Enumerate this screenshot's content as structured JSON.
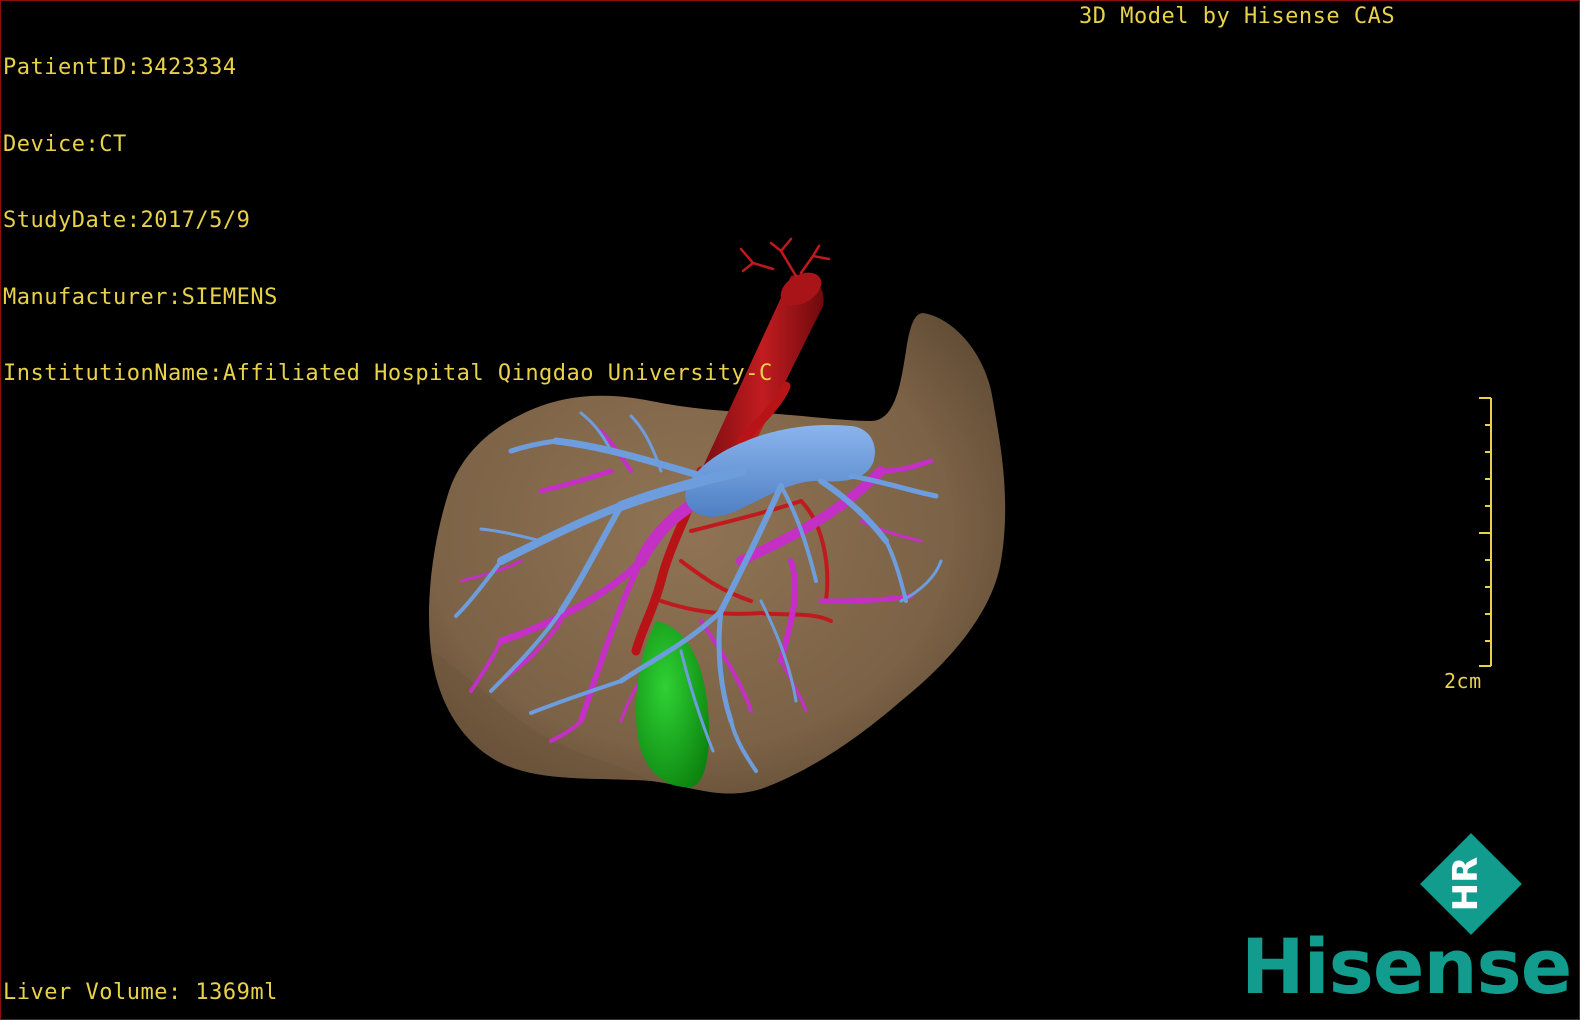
{
  "info": {
    "patient_id": "PatientID:3423334",
    "device": "Device:CT",
    "study_date": "StudyDate:2017/5/9",
    "manufacturer": "Manufacturer:SIEMENS",
    "institution": "InstitutionName:Affiliated Hospital Qingdao University-C"
  },
  "model_credit": "3D Model by Hisense CAS",
  "liver_volume": "Liver Volume: 1369ml",
  "scale": {
    "label": "2cm"
  },
  "logo": {
    "wordmark": "Hisense",
    "emblem_letters": "HR"
  },
  "colors": {
    "overlay_text": "#e8d24a",
    "liver": "#8a6d4e",
    "artery": "#b0161a",
    "portal_vein": "#6a98d8",
    "hepatic_vein": "#c630c8",
    "gallbladder": "#19b21c",
    "brand": "#119c8d"
  }
}
